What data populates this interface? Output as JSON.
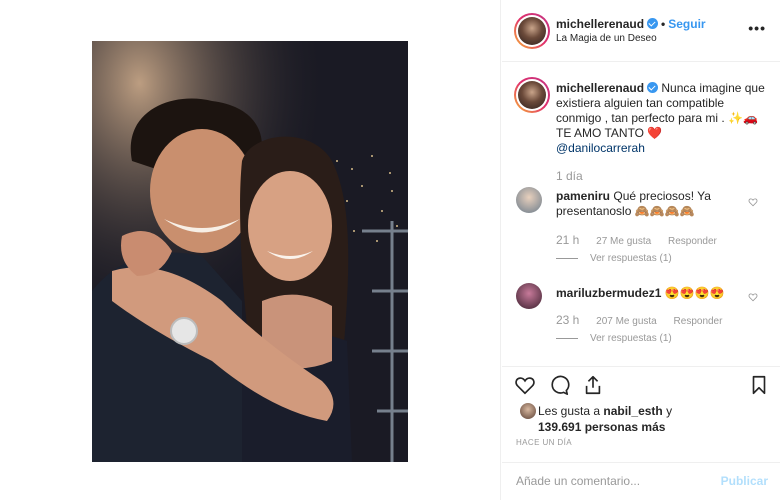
{
  "post": {
    "username": "michellerenaud",
    "follow_label": "Seguir",
    "separator": "•",
    "location": "La Magia de un Deseo",
    "more_label": "•••",
    "caption": {
      "username": "michellerenaud",
      "text": "Nunca imagine que existiera alguien tan compatible conmigo , tan perfecto para mi .",
      "emojis": "✨🚗",
      "line2": "TE AMO TANTO",
      "heart": "❤️",
      "mention": "@danilocarrerah",
      "time": "1 día"
    }
  },
  "comments": [
    {
      "username": "pameniru",
      "text": "Qué preciosos! Ya presentanoslo",
      "emojis": "🙈🙈🙈🙈",
      "time": "21 h",
      "likes": "27 Me gusta",
      "reply": "Responder",
      "replies": "Ver respuestas (1)"
    },
    {
      "username": "mariluzbermudez1",
      "text": "",
      "emojis": "😍😍😍😍",
      "time": "23 h",
      "likes": "207 Me gusta",
      "reply": "Responder",
      "replies": "Ver respuestas (1)"
    }
  ],
  "likes": {
    "prefix": "Les gusta a",
    "liker": "nabil_esth",
    "and": "y",
    "count": "139.691 personas más"
  },
  "posted_ago": "HACE UN DÍA",
  "comment_box": {
    "placeholder": "Añade un comentario...",
    "publish_label": "Publicar"
  },
  "icons": [
    "heart-icon",
    "comment-icon",
    "share-icon",
    "bookmark-icon",
    "more-options-icon",
    "verified-icon"
  ],
  "colors": {
    "accent": "#3897f0",
    "muted": "#999999",
    "border": "#efefef",
    "text": "#262626"
  }
}
